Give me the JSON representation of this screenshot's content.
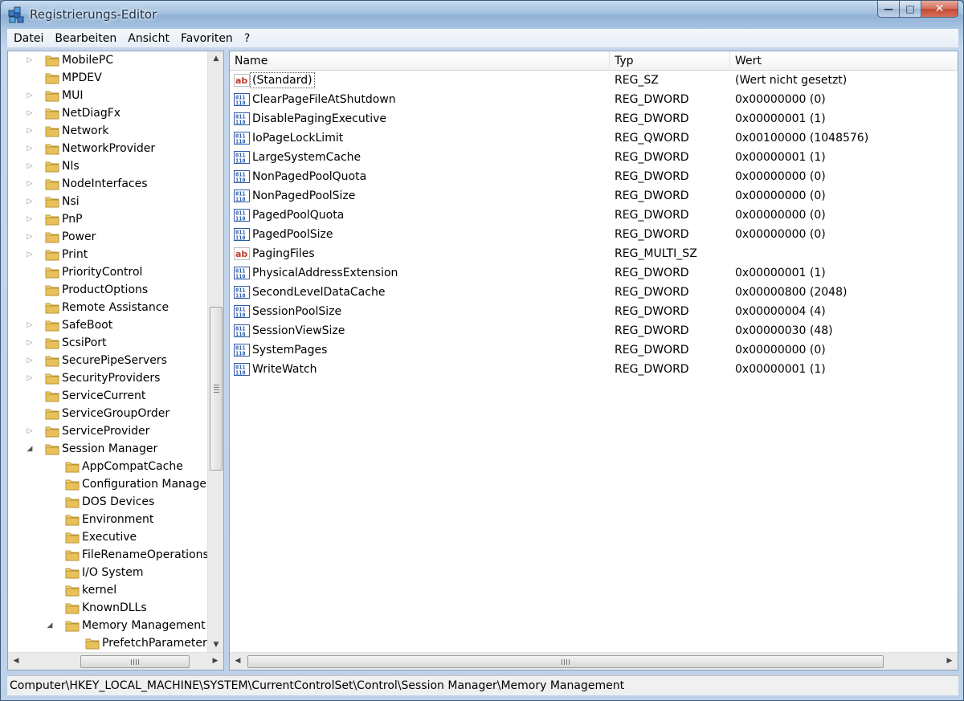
{
  "window": {
    "title": "Registrierungs-Editor"
  },
  "menu": [
    "Datei",
    "Bearbeiten",
    "Ansicht",
    "Favoriten",
    "?"
  ],
  "tree": [
    {
      "label": "MobilePC",
      "level": 1,
      "expander": "collapsed"
    },
    {
      "label": "MPDEV",
      "level": 1,
      "expander": "none"
    },
    {
      "label": "MUI",
      "level": 1,
      "expander": "collapsed"
    },
    {
      "label": "NetDiagFx",
      "level": 1,
      "expander": "collapsed"
    },
    {
      "label": "Network",
      "level": 1,
      "expander": "collapsed"
    },
    {
      "label": "NetworkProvider",
      "level": 1,
      "expander": "collapsed"
    },
    {
      "label": "Nls",
      "level": 1,
      "expander": "collapsed"
    },
    {
      "label": "NodeInterfaces",
      "level": 1,
      "expander": "collapsed"
    },
    {
      "label": "Nsi",
      "level": 1,
      "expander": "collapsed"
    },
    {
      "label": "PnP",
      "level": 1,
      "expander": "collapsed"
    },
    {
      "label": "Power",
      "level": 1,
      "expander": "collapsed"
    },
    {
      "label": "Print",
      "level": 1,
      "expander": "collapsed"
    },
    {
      "label": "PriorityControl",
      "level": 1,
      "expander": "none"
    },
    {
      "label": "ProductOptions",
      "level": 1,
      "expander": "none"
    },
    {
      "label": "Remote Assistance",
      "level": 1,
      "expander": "none"
    },
    {
      "label": "SafeBoot",
      "level": 1,
      "expander": "collapsed"
    },
    {
      "label": "ScsiPort",
      "level": 1,
      "expander": "collapsed"
    },
    {
      "label": "SecurePipeServers",
      "level": 1,
      "expander": "collapsed"
    },
    {
      "label": "SecurityProviders",
      "level": 1,
      "expander": "collapsed"
    },
    {
      "label": "ServiceCurrent",
      "level": 1,
      "expander": "none"
    },
    {
      "label": "ServiceGroupOrder",
      "level": 1,
      "expander": "none"
    },
    {
      "label": "ServiceProvider",
      "level": 1,
      "expander": "collapsed"
    },
    {
      "label": "Session Manager",
      "level": 1,
      "expander": "expanded"
    },
    {
      "label": "AppCompatCache",
      "level": 2,
      "expander": "none"
    },
    {
      "label": "Configuration Manager",
      "level": 2,
      "expander": "none"
    },
    {
      "label": "DOS Devices",
      "level": 2,
      "expander": "none"
    },
    {
      "label": "Environment",
      "level": 2,
      "expander": "none"
    },
    {
      "label": "Executive",
      "level": 2,
      "expander": "none"
    },
    {
      "label": "FileRenameOperations",
      "level": 2,
      "expander": "none"
    },
    {
      "label": "I/O System",
      "level": 2,
      "expander": "none"
    },
    {
      "label": "kernel",
      "level": 2,
      "expander": "none"
    },
    {
      "label": "KnownDLLs",
      "level": 2,
      "expander": "none"
    },
    {
      "label": "Memory Management",
      "level": 2,
      "expander": "expanded"
    },
    {
      "label": "PrefetchParameters",
      "level": 3,
      "expander": "none"
    }
  ],
  "list": {
    "columns": {
      "name": "Name",
      "type": "Typ",
      "value": "Wert"
    },
    "rows": [
      {
        "name": "(Standard)",
        "type": "REG_SZ",
        "value": "(Wert nicht gesetzt)",
        "icon": "string-value-icon",
        "selected": true
      },
      {
        "name": "ClearPageFileAtShutdown",
        "type": "REG_DWORD",
        "value": "0x00000000 (0)",
        "icon": "binary-value-icon"
      },
      {
        "name": "DisablePagingExecutive",
        "type": "REG_DWORD",
        "value": "0x00000001 (1)",
        "icon": "binary-value-icon"
      },
      {
        "name": "IoPageLockLimit",
        "type": "REG_QWORD",
        "value": "0x00100000 (1048576)",
        "icon": "binary-value-icon"
      },
      {
        "name": "LargeSystemCache",
        "type": "REG_DWORD",
        "value": "0x00000001 (1)",
        "icon": "binary-value-icon"
      },
      {
        "name": "NonPagedPoolQuota",
        "type": "REG_DWORD",
        "value": "0x00000000 (0)",
        "icon": "binary-value-icon"
      },
      {
        "name": "NonPagedPoolSize",
        "type": "REG_DWORD",
        "value": "0x00000000 (0)",
        "icon": "binary-value-icon"
      },
      {
        "name": "PagedPoolQuota",
        "type": "REG_DWORD",
        "value": "0x00000000 (0)",
        "icon": "binary-value-icon"
      },
      {
        "name": "PagedPoolSize",
        "type": "REG_DWORD",
        "value": "0x00000000 (0)",
        "icon": "binary-value-icon"
      },
      {
        "name": "PagingFiles",
        "type": "REG_MULTI_SZ",
        "value": "",
        "icon": "string-value-icon"
      },
      {
        "name": "PhysicalAddressExtension",
        "type": "REG_DWORD",
        "value": "0x00000001 (1)",
        "icon": "binary-value-icon"
      },
      {
        "name": "SecondLevelDataCache",
        "type": "REG_DWORD",
        "value": "0x00000800 (2048)",
        "icon": "binary-value-icon"
      },
      {
        "name": "SessionPoolSize",
        "type": "REG_DWORD",
        "value": "0x00000004 (4)",
        "icon": "binary-value-icon"
      },
      {
        "name": "SessionViewSize",
        "type": "REG_DWORD",
        "value": "0x00000030 (48)",
        "icon": "binary-value-icon"
      },
      {
        "name": "SystemPages",
        "type": "REG_DWORD",
        "value": "0x00000000 (0)",
        "icon": "binary-value-icon"
      },
      {
        "name": "WriteWatch",
        "type": "REG_DWORD",
        "value": "0x00000001 (1)",
        "icon": "binary-value-icon"
      }
    ]
  },
  "status": {
    "path": "Computer\\HKEY_LOCAL_MACHINE\\SYSTEM\\CurrentControlSet\\Control\\Session Manager\\Memory Management"
  },
  "colors": {
    "folder": "#e8c15a",
    "string_icon": "#c0392b",
    "binary_icon": "#2b5aa8",
    "frame": "#a9c4e2"
  }
}
